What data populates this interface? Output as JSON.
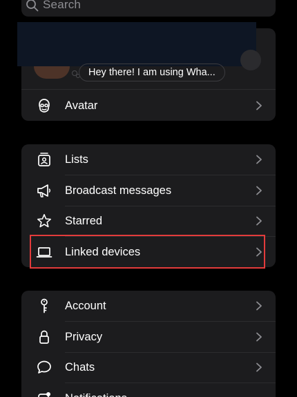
{
  "search": {
    "placeholder": "Search",
    "icon": "search-icon"
  },
  "profile": {
    "status": "Hey there! I am using Wha...",
    "avatar_item": {
      "label": "Avatar",
      "icon": "avatar-face-icon"
    }
  },
  "group2": {
    "items": [
      {
        "label": "Lists",
        "icon": "lists-icon"
      },
      {
        "label": "Broadcast messages",
        "icon": "megaphone-icon"
      },
      {
        "label": "Starred",
        "icon": "star-icon"
      },
      {
        "label": "Linked devices",
        "icon": "laptop-icon"
      }
    ]
  },
  "group3": {
    "items": [
      {
        "label": "Account",
        "icon": "key-icon"
      },
      {
        "label": "Privacy",
        "icon": "lock-icon"
      },
      {
        "label": "Chats",
        "icon": "chat-bubble-icon"
      },
      {
        "label": "Notifications",
        "icon": "notification-icon"
      }
    ]
  },
  "colors": {
    "background": "#000000",
    "card": "#1c1c1e",
    "highlight": "#e33b3b",
    "secondary_text": "#8d8d92"
  }
}
